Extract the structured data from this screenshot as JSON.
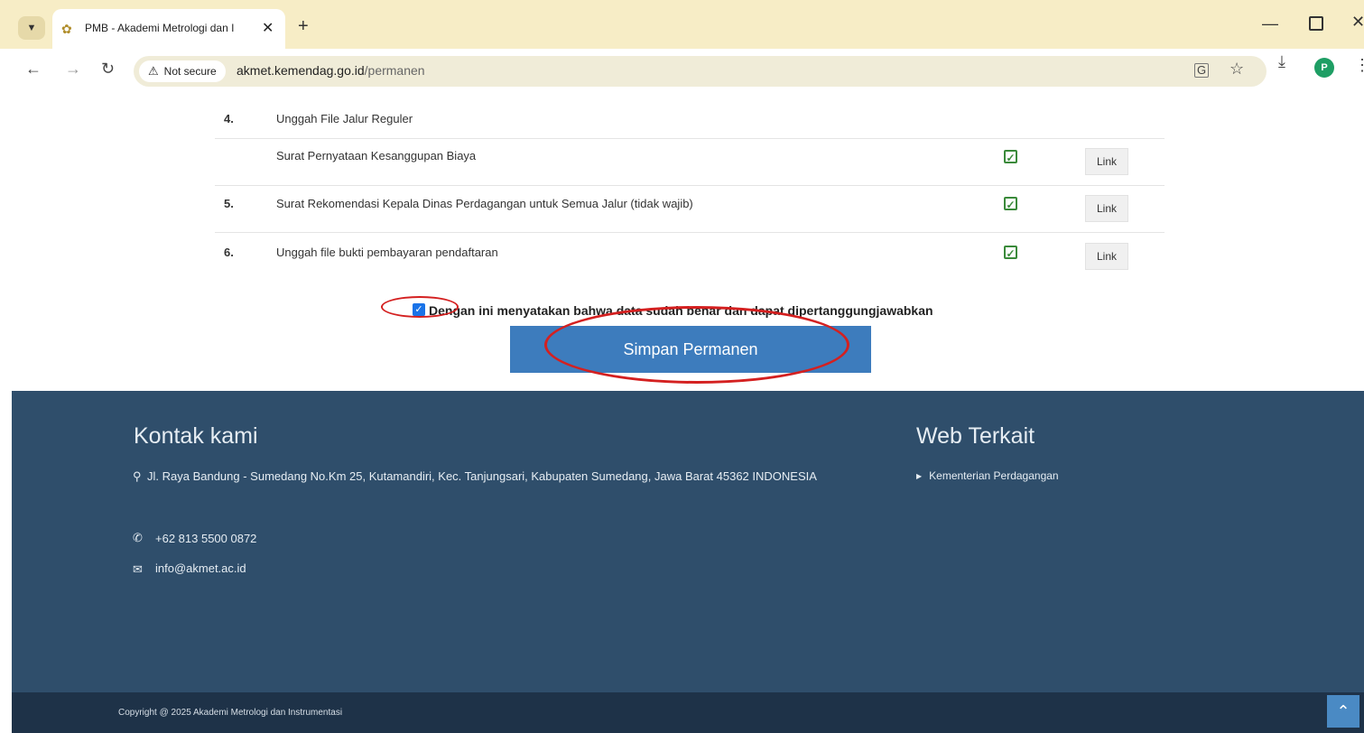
{
  "browser": {
    "tab_title": "PMB - Akademi Metrologi dan I",
    "security_label": "Not secure",
    "url_host": "akmet.kemendag.go.id",
    "url_path": "/permanen",
    "profile_initial": "P"
  },
  "documents": [
    {
      "num": "4.",
      "label": "Unggah File Jalur Reguler",
      "checked": false,
      "link": ""
    },
    {
      "num": "",
      "label": "Surat Pernyataan Kesanggupan Biaya",
      "checked": true,
      "link": "Link"
    },
    {
      "num": "5.",
      "label": "Surat Rekomendasi Kepala Dinas Perdagangan untuk Semua Jalur (tidak wajib)",
      "checked": true,
      "link": "Link"
    },
    {
      "num": "6.",
      "label": "Unggah file bukti pembayaran pendaftaran",
      "checked": true,
      "link": "Link"
    }
  ],
  "agreement": {
    "text": "Dengan ini menyatakan bahwa data sudah benar dan dapat dipertanggungjawabkan",
    "checked": true
  },
  "save_button": "Simpan Permanen",
  "footer": {
    "contact_title": "Kontak kami",
    "address": "Jl. Raya Bandung - Sumedang No.Km 25, Kutamandiri, Kec. Tanjungsari, Kabupaten Sumedang, Jawa Barat 45362 INDONESIA",
    "phone": "+62 813 5500 0872",
    "email": "info@akmet.ac.id",
    "web_title": "Web Terkait",
    "web_links": [
      "Kementerian Perdagangan"
    ],
    "copyright": "Copyright @ 2025 Akademi Metrologi dan Instrumentasi"
  },
  "colors": {
    "tabstrip": "#f7edc6",
    "save_button": "#3d7cbd",
    "footer": "#2f4e6b",
    "footer_bottom": "#1e3248",
    "annotation": "#d42020",
    "checkmark": "#3a8a3a"
  },
  "icons": {
    "tab_favicon": "akmet-logo-icon",
    "address": "map-marker-icon",
    "phone": "phone-icon",
    "email": "envelope-icon",
    "scroll_top": "chevron-up-icon"
  }
}
